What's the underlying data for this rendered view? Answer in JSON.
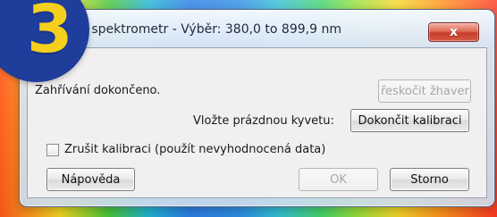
{
  "badge": {
    "number": "3"
  },
  "window": {
    "title": "ovat spektrometr - Výběr: 380,0 to 899,9 nm",
    "close_label": "x"
  },
  "dialog": {
    "status_text": "Zahřívání dokončeno.",
    "skip_warmup_label": "řeskočit žhaver",
    "instruction_label": "Vložte prázdnou kyvetu:",
    "finish_calibration_label": "Dokončit kalibraci",
    "cancel_calibration_checkbox_label": "Zrušit kalibraci (použít nevyhodnocená data)",
    "help_label": "Nápověda",
    "ok_label": "OK",
    "cancel_label": "Storno"
  }
}
